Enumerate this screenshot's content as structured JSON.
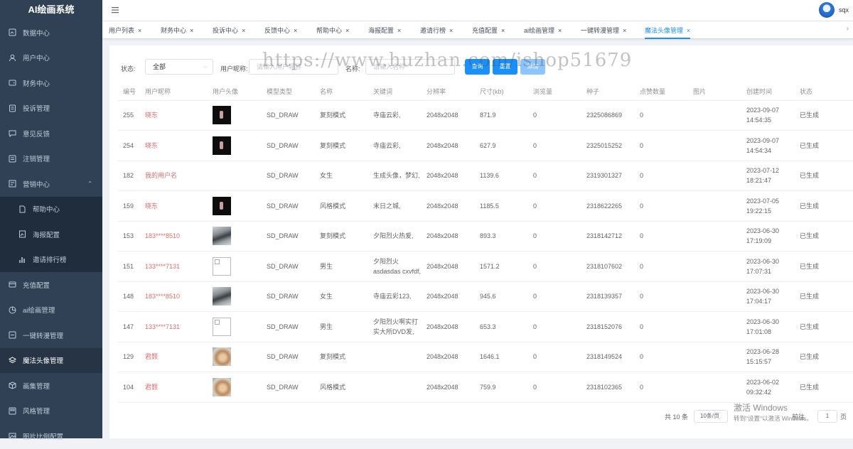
{
  "app": {
    "title": "AI绘画系统",
    "username": "sqx"
  },
  "sidebar": {
    "items": [
      {
        "label": "数据中心",
        "icon": "dashboard-icon"
      },
      {
        "label": "用户中心",
        "icon": "user-icon"
      },
      {
        "label": "财务中心",
        "icon": "wallet-icon"
      },
      {
        "label": "投诉管理",
        "icon": "complaint-icon"
      },
      {
        "label": "意见反馈",
        "icon": "chat-icon"
      },
      {
        "label": "注销管理",
        "icon": "logout-icon"
      },
      {
        "label": "营销中心",
        "icon": "marketing-icon"
      },
      {
        "label": "帮助中心",
        "icon": "document-icon"
      },
      {
        "label": "海报配置",
        "icon": "poster-icon"
      },
      {
        "label": "邀请排行榜",
        "icon": "chart-icon"
      },
      {
        "label": "充值配置",
        "icon": "recharge-icon"
      },
      {
        "label": "ai绘画管理",
        "icon": "palette-icon"
      },
      {
        "label": "一键转漫管理",
        "icon": "convert-icon"
      },
      {
        "label": "魔法头像管理",
        "icon": "layers-icon"
      },
      {
        "label": "画集管理",
        "icon": "cube-icon"
      },
      {
        "label": "风格管理",
        "icon": "style-icon"
      },
      {
        "label": "图片比例配置",
        "icon": "image-icon"
      }
    ]
  },
  "tags": [
    {
      "label": "用户列表"
    },
    {
      "label": "财务中心"
    },
    {
      "label": "投诉中心"
    },
    {
      "label": "反馈中心"
    },
    {
      "label": "帮助中心"
    },
    {
      "label": "海报配置"
    },
    {
      "label": "邀请行榜"
    },
    {
      "label": "充值配置"
    },
    {
      "label": "ai绘画管理"
    },
    {
      "label": "一键转漫管理"
    },
    {
      "label": "魔法头像管理"
    }
  ],
  "filters": {
    "status_label": "状态:",
    "status_value": "全部",
    "nickname_label": "用户昵称:",
    "nickname_placeholder": "请输入用户昵称",
    "name_label": "名称:",
    "name_placeholder": "请输入名称",
    "search_btn": "查询",
    "reset_btn": "重置",
    "add_btn": "添加"
  },
  "watermark": "https://www.huzhan.com/ishop51679",
  "table": {
    "columns": [
      "编号",
      "用户昵称",
      "用户头像",
      "模型类型",
      "名称",
      "关键词",
      "分辨率",
      "尺寸(kb)",
      "浏览量",
      "种子",
      "点赞数量",
      "图片",
      "创建时间",
      "状态"
    ],
    "rows": [
      {
        "id": "255",
        "user": "晓东",
        "avatar": "dark",
        "model": "SD_DRAW",
        "name": "复刻模式",
        "keyword": "寺庙云彩,",
        "res": "2048x2048",
        "size": "871.9",
        "views": "0",
        "seed": "2325086869",
        "likes": "0",
        "time": "2023-09-07 14:54:35",
        "status": "已生成"
      },
      {
        "id": "254",
        "user": "晓东",
        "avatar": "dark",
        "model": "SD_DRAW",
        "name": "复刻模式",
        "keyword": "寺庙云彩,",
        "res": "2048x2048",
        "size": "627.9",
        "views": "0",
        "seed": "2325015252",
        "likes": "0",
        "time": "2023-09-07 14:54:34",
        "status": "已生成"
      },
      {
        "id": "182",
        "user": "我的用户名",
        "avatar": "none",
        "model": "SD_DRAW",
        "name": "女生",
        "keyword": "生成头像，梦幻,",
        "res": "2048x2048",
        "size": "1139.6",
        "views": "0",
        "seed": "2319301327",
        "likes": "0",
        "time": "2023-07-12 18:21:47",
        "status": "已生成"
      },
      {
        "id": "159",
        "user": "晓东",
        "avatar": "dark",
        "model": "SD_DRAW",
        "name": "风格模式",
        "keyword": "末日之城,",
        "res": "2048x2048",
        "size": "1185.5",
        "views": "0",
        "seed": "2318622265",
        "likes": "0",
        "time": "2023-07-05 19:22:15",
        "status": "已生成"
      },
      {
        "id": "153",
        "user": "183****8510",
        "avatar": "train",
        "model": "SD_DRAW",
        "name": "复刻模式",
        "keyword": "夕阳烈火热爱,",
        "res": "2048x2048",
        "size": "893.3",
        "views": "0",
        "seed": "2318142712",
        "likes": "0",
        "time": "2023-06-30 17:19:09",
        "status": "已生成"
      },
      {
        "id": "151",
        "user": "133****7131",
        "avatar": "broken",
        "model": "SD_DRAW",
        "name": "男生",
        "keyword": "夕阳烈火asdasdas cxvfdf,",
        "res": "2048x2048",
        "size": "1571.2",
        "views": "0",
        "seed": "2318107602",
        "likes": "0",
        "time": "2023-06-30 17:07:31",
        "status": "已生成"
      },
      {
        "id": "148",
        "user": "183****8510",
        "avatar": "train",
        "model": "SD_DRAW",
        "name": "女生",
        "keyword": "寺庙云彩123,",
        "res": "2048x2048",
        "size": "945.6",
        "views": "0",
        "seed": "2318139357",
        "likes": "0",
        "time": "2023-06-30 17:04:17",
        "status": "已生成"
      },
      {
        "id": "147",
        "user": "133****7131",
        "avatar": "broken",
        "model": "SD_DRAW",
        "name": "男生",
        "keyword": "夕阳烈火啊实打实大所DVD发,",
        "res": "2048x2048",
        "size": "653.3",
        "views": "0",
        "seed": "2318152076",
        "likes": "0",
        "time": "2023-06-30 17:01:08",
        "status": "已生成"
      },
      {
        "id": "129",
        "user": "君颢",
        "avatar": "pet",
        "model": "SD_DRAW",
        "name": "复刻模式",
        "keyword": "",
        "res": "2048x2048",
        "size": "1646.1",
        "views": "0",
        "seed": "2318149524",
        "likes": "0",
        "time": "2023-06-28 15:15:57",
        "status": "已生成"
      },
      {
        "id": "104",
        "user": "君颢",
        "avatar": "pet",
        "model": "SD_DRAW",
        "name": "风格模式",
        "keyword": "",
        "res": "2048x2048",
        "size": "759.9",
        "views": "0",
        "seed": "2318102365",
        "likes": "0",
        "time": "2023-06-02 09:32:42",
        "status": "已生成"
      }
    ]
  },
  "pagination": {
    "total": "共 10 条",
    "page_size": "10条/页",
    "goto": "前往",
    "page": "1",
    "unit": "页"
  },
  "activation": {
    "line1": "激活 Windows",
    "line2": "转到\"设置\"以激活 Windows。"
  }
}
